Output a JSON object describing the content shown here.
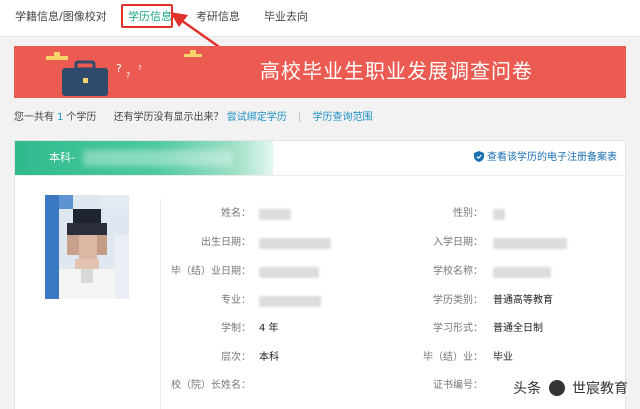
{
  "nav": {
    "tabs": [
      {
        "label": "学籍信息/图像校对",
        "active": false
      },
      {
        "label": "学历信息",
        "active": true
      },
      {
        "label": "考研信息",
        "active": false
      },
      {
        "label": "毕业去向",
        "active": false
      }
    ]
  },
  "banner": {
    "title": "高校毕业生职业发展调查问卷",
    "background_color": "#ec5b52"
  },
  "summary": {
    "prefix": "您一共有",
    "count": "1",
    "suffix": "个学历",
    "question": "还有学历没有显示出来？",
    "bind_link": "尝试绑定学历",
    "scope_link": "学历查询范围"
  },
  "card": {
    "level_label": "本科-",
    "cert_link": "查看该学历的电子注册备案表",
    "left_fields": [
      {
        "label": "姓名：",
        "value": ""
      },
      {
        "label": "出生日期：",
        "value": ""
      },
      {
        "label": "毕（结）业日期：",
        "value": ""
      },
      {
        "label": "专业：",
        "value": ""
      },
      {
        "label": "学制：",
        "value": "4 年"
      },
      {
        "label": "层次：",
        "value": "本科"
      },
      {
        "label": "校（院）长姓名：",
        "value": ""
      }
    ],
    "right_fields": [
      {
        "label": "性别：",
        "value": ""
      },
      {
        "label": "入学日期：",
        "value": ""
      },
      {
        "label": "学校名称：",
        "value": ""
      },
      {
        "label": "学历类别：",
        "value": "普通高等教育"
      },
      {
        "label": "学习形式：",
        "value": "普通全日制"
      },
      {
        "label": "毕（结）业：",
        "value": "毕业"
      },
      {
        "label": "证书编号：",
        "value": ""
      }
    ]
  },
  "watermark": {
    "prefix": "头条",
    "handle": "世宸教育"
  },
  "colors": {
    "accent_green": "#1aa37a",
    "link_blue": "#1a8ec7",
    "highlight_red": "#e0322b"
  }
}
